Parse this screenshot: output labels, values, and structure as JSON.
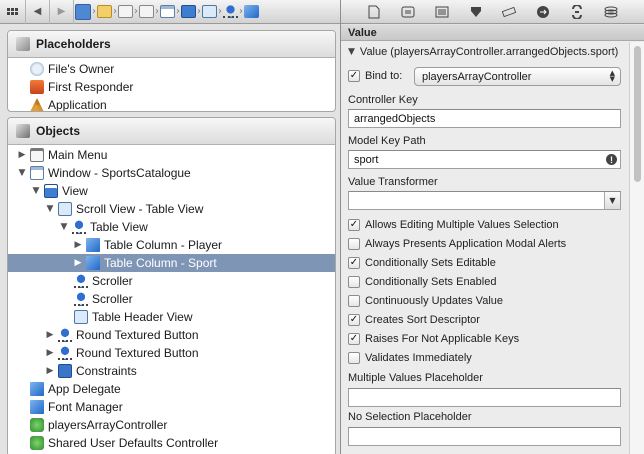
{
  "jumpbar": {
    "crumbs": [
      "doc-icon",
      "folder-icon",
      "xib-icon",
      "xib-icon",
      "window-icon",
      "scrollview-icon",
      "tableview-icon",
      "tableview-icon",
      "column-icon"
    ]
  },
  "inspector_toolbar": {
    "tabs": [
      "file-inspector-icon",
      "quick-help-icon",
      "identity-inspector-icon",
      "attributes-inspector-icon",
      "size-inspector-icon",
      "connections-inspector-icon",
      "bindings-inspector-icon",
      "view-effects-inspector-icon"
    ]
  },
  "placeholders": {
    "title": "Placeholders",
    "items": [
      {
        "label": "File's Owner",
        "icon": "files-owner-icon"
      },
      {
        "label": "First Responder",
        "icon": "first-responder-icon"
      },
      {
        "label": "Application",
        "icon": "application-icon"
      }
    ]
  },
  "objects": {
    "title": "Objects",
    "items": [
      {
        "label": "Main Menu",
        "icon": "menu-icon",
        "disclosure": "collapsed"
      },
      {
        "label": "Window - SportsCatalogue",
        "icon": "window-icon",
        "disclosure": "expanded"
      },
      {
        "label": "View",
        "icon": "view-icon",
        "disclosure": "expanded"
      },
      {
        "label": "Scroll View - Table View",
        "icon": "scroll-view-icon",
        "disclosure": "expanded"
      },
      {
        "label": "Table View",
        "icon": "table-view-icon",
        "disclosure": "expanded"
      },
      {
        "label": "Table Column - Player",
        "icon": "table-column-icon",
        "disclosure": "collapsed"
      },
      {
        "label": "Table Column - Sport",
        "icon": "table-column-icon",
        "disclosure": "collapsed",
        "selected": true
      },
      {
        "label": "Scroller",
        "icon": "scroller-icon",
        "disclosure": "none"
      },
      {
        "label": "Scroller",
        "icon": "scroller-icon",
        "disclosure": "none"
      },
      {
        "label": "Table Header View",
        "icon": "table-header-icon",
        "disclosure": "none"
      },
      {
        "label": "Round Textured Button",
        "icon": "button-icon",
        "disclosure": "collapsed"
      },
      {
        "label": "Round Textured Button",
        "icon": "button-icon",
        "disclosure": "collapsed"
      },
      {
        "label": "Constraints",
        "icon": "constraints-icon",
        "disclosure": "collapsed"
      },
      {
        "label": "App Delegate",
        "icon": "object-icon",
        "disclosure": "none"
      },
      {
        "label": "Font Manager",
        "icon": "object-icon",
        "disclosure": "none"
      },
      {
        "label": "playersArrayController",
        "icon": "array-controller-icon",
        "disclosure": "none"
      },
      {
        "label": "Shared User Defaults Controller",
        "icon": "user-defaults-controller-icon",
        "disclosure": "none"
      }
    ]
  },
  "inspector": {
    "header": "Value",
    "section": "Value (playersArrayController.arrangedObjects.sport)",
    "bind_to_label": "Bind to:",
    "bind_to_checked": true,
    "bind_to_value": "playersArrayController",
    "controller_key_label": "Controller Key",
    "controller_key_value": "arrangedObjects",
    "model_key_path_label": "Model Key Path",
    "model_key_path_value": "sport",
    "value_transformer_label": "Value Transformer",
    "value_transformer_value": "",
    "options": [
      {
        "label": "Allows Editing Multiple Values Selection",
        "checked": true
      },
      {
        "label": "Always Presents Application Modal Alerts",
        "checked": false
      },
      {
        "label": "Conditionally Sets Editable",
        "checked": true
      },
      {
        "label": "Conditionally Sets Enabled",
        "checked": false
      },
      {
        "label": "Continuously Updates Value",
        "checked": false
      },
      {
        "label": "Creates Sort Descriptor",
        "checked": true
      },
      {
        "label": "Raises For Not Applicable Keys",
        "checked": true
      },
      {
        "label": "Validates Immediately",
        "checked": false
      }
    ],
    "multiple_values_placeholder_label": "Multiple Values Placeholder",
    "multiple_values_placeholder_value": "",
    "no_selection_placeholder_label": "No Selection Placeholder",
    "no_selection_placeholder_value": ""
  },
  "colors": {
    "selection": "#7f95b6",
    "chrome": "#e3e3e3",
    "accent_blue": "#1f69c7"
  }
}
